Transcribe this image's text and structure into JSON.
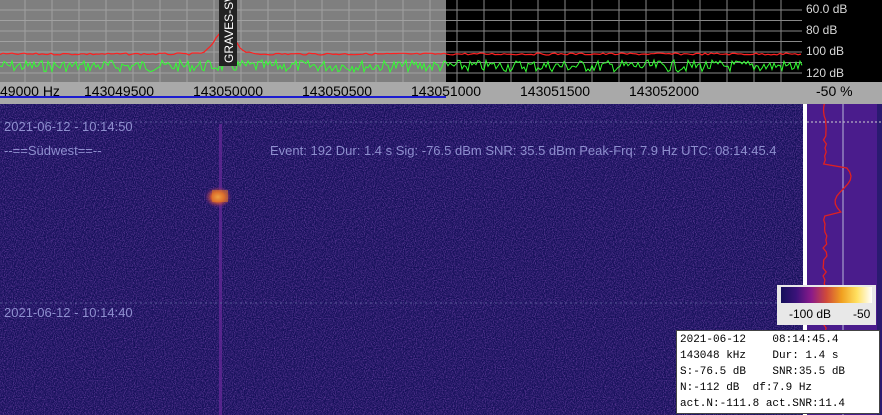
{
  "spectrum": {
    "db_labels": [
      "60.0 dB",
      "80 dB",
      "100 dB",
      "120 dB"
    ],
    "marker_label": "GRAVES-SW"
  },
  "freq_axis": {
    "labels": [
      "49000 Hz",
      "143049500",
      "143050000",
      "143050500",
      "143051000",
      "143051500",
      "143052000"
    ]
  },
  "percent": "-50 %",
  "waterfall": {
    "timestamp_1": "2021-06-12 - 10:14:50",
    "station_label": "--==Südwest==--",
    "event_info": "Event: 192   Dur: 1.4 s   Sig: -76.5 dBm   SNR: 35.5 dBm   Peak-Frq: 7.9 Hz   UTC: 08:14:45.4",
    "timestamp_2": "2021-06-12 - 10:14:40"
  },
  "colorbar": {
    "min_label": "-100 dB",
    "max_label": "-50"
  },
  "info_box": {
    "line1": "2021-06-12    08:14:45.4",
    "line2": "143048 kHz    Dur: 1.4 s",
    "line3": "S:-76.5 dB    SNR:35.5 dB",
    "line4": "N:-112 dB  df:7.9 Hz",
    "line5": "act.N:-111.8 act.SNR:11.4"
  },
  "colors": {
    "background": "#15105a",
    "spectrum_grey": "#7f7f7f",
    "noise_trace": "#33ff33",
    "peak_trace": "#ff2020"
  }
}
